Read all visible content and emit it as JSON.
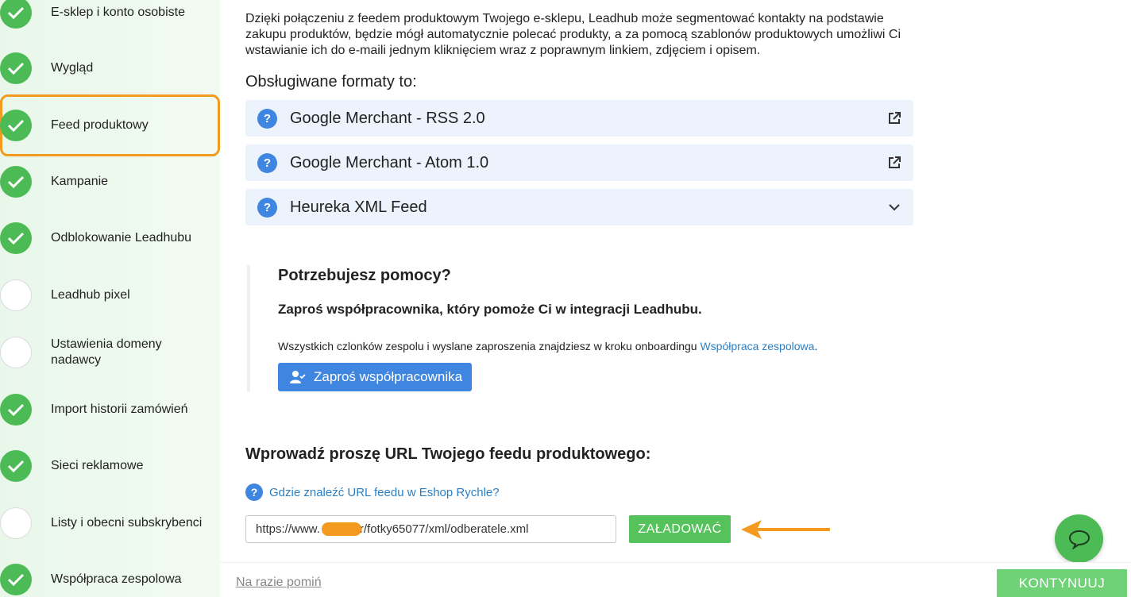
{
  "sidebar": {
    "items": [
      {
        "label": "E-sklep i konto osobiste",
        "status": "done"
      },
      {
        "label": "Wygląd",
        "status": "done"
      },
      {
        "label": "Feed produktowy",
        "status": "done",
        "active": true
      },
      {
        "label": "Kampanie",
        "status": "done"
      },
      {
        "label": "Odblokowanie Leadhubu",
        "status": "done"
      },
      {
        "label": "Leadhub pixel",
        "status": "todo"
      },
      {
        "label": "Ustawienia domeny nadawcy",
        "status": "todo"
      },
      {
        "label": "Import historii zamówień",
        "status": "done"
      },
      {
        "label": "Sieci reklamowe",
        "status": "done"
      },
      {
        "label": "Listy i obecni subskrybenci",
        "status": "todo"
      },
      {
        "label": "Współpraca zespolowa",
        "status": "done"
      }
    ]
  },
  "main": {
    "intro": "Dzięki połączeniu z feedem produktowym Twojego e-sklepu, Leadhub może segmentować kontakty na podstawie zakupu produktów, będzie mógł automatycznie polecać produkty, a za pomocą szablonów produktowych umożliwi Ci wstawianie ich do e-maili jednym kliknięciem wraz z poprawnym linkiem, zdjęciem i opisem.",
    "formats_title": "Obsługiwane formaty to:",
    "formats": [
      {
        "label": "Google Merchant - RSS 2.0",
        "icon": "external-link-icon"
      },
      {
        "label": "Google Merchant - Atom 1.0",
        "icon": "external-link-icon"
      },
      {
        "label": "Heureka XML Feed",
        "icon": "chevron-down-icon"
      }
    ],
    "help": {
      "title": "Potrzebujesz pomocy?",
      "subtitle": "Zaproś współpracownika, który pomoże Ci w integracji Leadhubu.",
      "text": "Wszystkich czlonków zespolu i wyslane zaproszenia znajdziesz w kroku onboardingu ",
      "link": "Współpraca zespolowa",
      "text_end": ".",
      "button": "Zaproś współpracownika"
    },
    "url_title": "Wprowadź proszę URL Twojego feedu produktowego:",
    "where_link": "Gdzie znaleźć URL feedu w Eshop Rychle?",
    "url_prefix": "https://www.",
    "url_suffix": "r/fotky65077/xml/odberatele.xml",
    "load_button": "ZAŁADOWAĆ"
  },
  "footer": {
    "skip": "Na razie pomiń",
    "continue": "KONTYNUUJ"
  },
  "colors": {
    "green": "#4cbb55",
    "blue": "#3f86e0",
    "orange": "#f39a1f",
    "link": "#2a7fc4"
  }
}
